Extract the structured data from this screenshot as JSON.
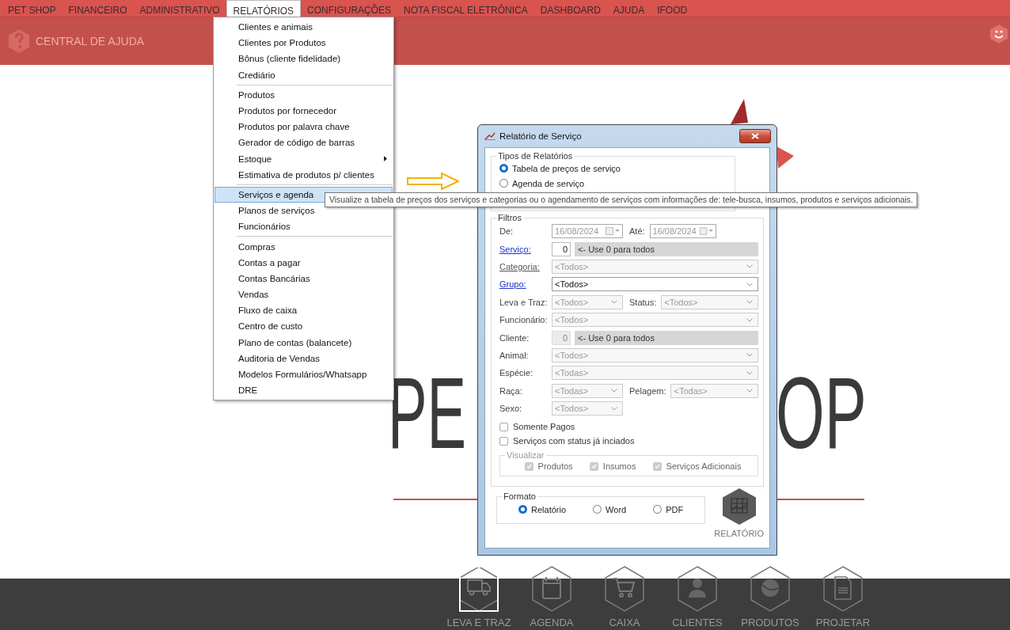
{
  "menubar": [
    {
      "label": "PET SHOP",
      "selected": false
    },
    {
      "label": "FINANCEIRO",
      "selected": false
    },
    {
      "label": "ADMINISTRATIVO",
      "selected": false
    },
    {
      "label": "RELATÓRIOS",
      "selected": true
    },
    {
      "label": "CONFIGURAÇÕES",
      "selected": false
    },
    {
      "label": "NOTA FISCAL ELETRÔNICA",
      "selected": false
    },
    {
      "label": "DASHBOARD",
      "selected": false
    },
    {
      "label": "AJUDA",
      "selected": false
    },
    {
      "label": "IFOOD",
      "selected": false
    }
  ],
  "header": {
    "title": "CENTRAL DE AJUDA"
  },
  "logo": {
    "left_text": "PE",
    "right_text": "OP"
  },
  "menu": {
    "groups": [
      [
        {
          "label": "Clientes e animais",
          "selected": false,
          "submenu": false
        },
        {
          "label": "Clientes por Produtos",
          "selected": false,
          "submenu": false
        },
        {
          "label": "Bônus (cliente fidelidade)",
          "selected": false,
          "submenu": false
        },
        {
          "label": "Crediário",
          "selected": false,
          "submenu": false
        }
      ],
      [
        {
          "label": "Produtos",
          "selected": false,
          "submenu": false
        },
        {
          "label": "Produtos por fornecedor",
          "selected": false,
          "submenu": false
        },
        {
          "label": "Produtos por palavra chave",
          "selected": false,
          "submenu": false
        },
        {
          "label": "Gerador de código de barras",
          "selected": false,
          "submenu": false
        },
        {
          "label": "Estoque",
          "selected": false,
          "submenu": true
        },
        {
          "label": "Estimativa de produtos p/ clientes",
          "selected": false,
          "submenu": false
        }
      ],
      [
        {
          "label": "Serviços e agenda",
          "selected": true,
          "submenu": false
        },
        {
          "label": "Planos de serviços",
          "selected": false,
          "submenu": false
        },
        {
          "label": "Funcionários",
          "selected": false,
          "submenu": false
        }
      ],
      [
        {
          "label": "Compras",
          "selected": false,
          "submenu": false
        },
        {
          "label": "Contas a pagar",
          "selected": false,
          "submenu": false
        },
        {
          "label": "Contas Bancárias",
          "selected": false,
          "submenu": false
        },
        {
          "label": "Vendas",
          "selected": false,
          "submenu": false
        },
        {
          "label": "Fluxo de caixa",
          "selected": false,
          "submenu": false
        },
        {
          "label": "Centro de custo",
          "selected": false,
          "submenu": false
        },
        {
          "label": "Plano de contas (balancete)",
          "selected": false,
          "submenu": false
        },
        {
          "label": "Auditoria de Vendas",
          "selected": false,
          "submenu": false
        },
        {
          "label": "Modelos Formulários/Whatsapp",
          "selected": false,
          "submenu": false
        },
        {
          "label": "DRE",
          "selected": false,
          "submenu": false
        }
      ]
    ]
  },
  "tooltip": "Visualize a tabela de preços dos serviços e categorias ou o agendamento de serviços com informações de: tele-busca, insumos, produtos e serviços adicionais.",
  "dialog": {
    "title": "Relatório de Serviço",
    "report_types": {
      "title": "Tipos de Relatórios",
      "options": [
        {
          "label": "Tabela de preços de serviço",
          "selected": true
        },
        {
          "label": "Agenda de serviço",
          "selected": false
        }
      ]
    },
    "filters": {
      "title": "Filtros",
      "rows": [
        [
          {
            "kind": "label",
            "text": "De:"
          },
          {
            "kind": "date",
            "value": "16/08/2024",
            "disabled": true
          },
          {
            "kind": "side-label",
            "text": "Até:"
          },
          {
            "kind": "date",
            "value": "16/08/2024",
            "disabled": true
          }
        ],
        [
          {
            "kind": "link",
            "text": "Serviço:",
            "disabled": false
          },
          {
            "kind": "number",
            "value": "0",
            "disabled": false
          },
          {
            "kind": "hint",
            "text": "<- Use 0 para todos"
          }
        ],
        [
          {
            "kind": "link",
            "text": "Categoria:",
            "disabled": true
          },
          {
            "kind": "select",
            "value": "<Todos>",
            "disabled": true
          }
        ],
        [
          {
            "kind": "link",
            "text": "Grupo:",
            "disabled": false
          },
          {
            "kind": "select",
            "value": "<Todos>",
            "disabled": false
          }
        ],
        [
          {
            "kind": "label",
            "text": "Leva e Traz:"
          },
          {
            "kind": "short-select",
            "value": "<Todos>",
            "disabled": true
          },
          {
            "kind": "side-label",
            "text": "Status:"
          },
          {
            "kind": "select",
            "value": "<Todos>",
            "disabled": true
          }
        ],
        [
          {
            "kind": "label",
            "text": "Funcionário:"
          },
          {
            "kind": "select",
            "value": "<Todos>",
            "disabled": true
          }
        ],
        [
          {
            "kind": "label",
            "text": "Cliente:"
          },
          {
            "kind": "number",
            "value": "0",
            "disabled": true
          },
          {
            "kind": "hint",
            "text": "<- Use 0 para todos"
          }
        ],
        [
          {
            "kind": "label",
            "text": "Animal:"
          },
          {
            "kind": "select",
            "value": "<Todos>",
            "disabled": true
          }
        ],
        [
          {
            "kind": "label",
            "text": "Espécie:"
          },
          {
            "kind": "select",
            "value": "<Todas>",
            "disabled": true
          }
        ],
        [
          {
            "kind": "label",
            "text": "Raça:"
          },
          {
            "kind": "short-select",
            "value": "<Todas>",
            "disabled": true
          },
          {
            "kind": "side-label",
            "text": "Pelagem:"
          },
          {
            "kind": "select",
            "value": "<Todas>",
            "disabled": true
          }
        ],
        [
          {
            "kind": "label",
            "text": "Sexo:"
          },
          {
            "kind": "short-select",
            "value": "<Todos>",
            "disabled": true
          }
        ]
      ],
      "checks": [
        {
          "label": "Somente Pagos",
          "checked": false
        },
        {
          "label": "Serviços com status já inciados",
          "checked": false
        }
      ],
      "visualizar": {
        "title": "Visualizar",
        "options": [
          {
            "label": "Produtos",
            "checked": true,
            "disabled": true
          },
          {
            "label": "Insumos",
            "checked": true,
            "disabled": true
          },
          {
            "label": "Serviços Adicionais",
            "checked": true,
            "disabled": true
          }
        ]
      }
    },
    "format": {
      "title": "Formato",
      "options": [
        {
          "label": "Relatório",
          "selected": true
        },
        {
          "label": "Word",
          "selected": false
        },
        {
          "label": "PDF",
          "selected": false
        }
      ]
    },
    "report_button": "RELATÓRIO"
  },
  "bottom_nav": [
    {
      "label": "LEVA E TRAZ",
      "selected": true
    },
    {
      "label": "AGENDA",
      "selected": false
    },
    {
      "label": "CAIXA",
      "selected": false
    },
    {
      "label": "CLIENTES",
      "selected": false
    },
    {
      "label": "PRODUTOS",
      "selected": false
    },
    {
      "label": "PROJETAR",
      "selected": false
    }
  ]
}
